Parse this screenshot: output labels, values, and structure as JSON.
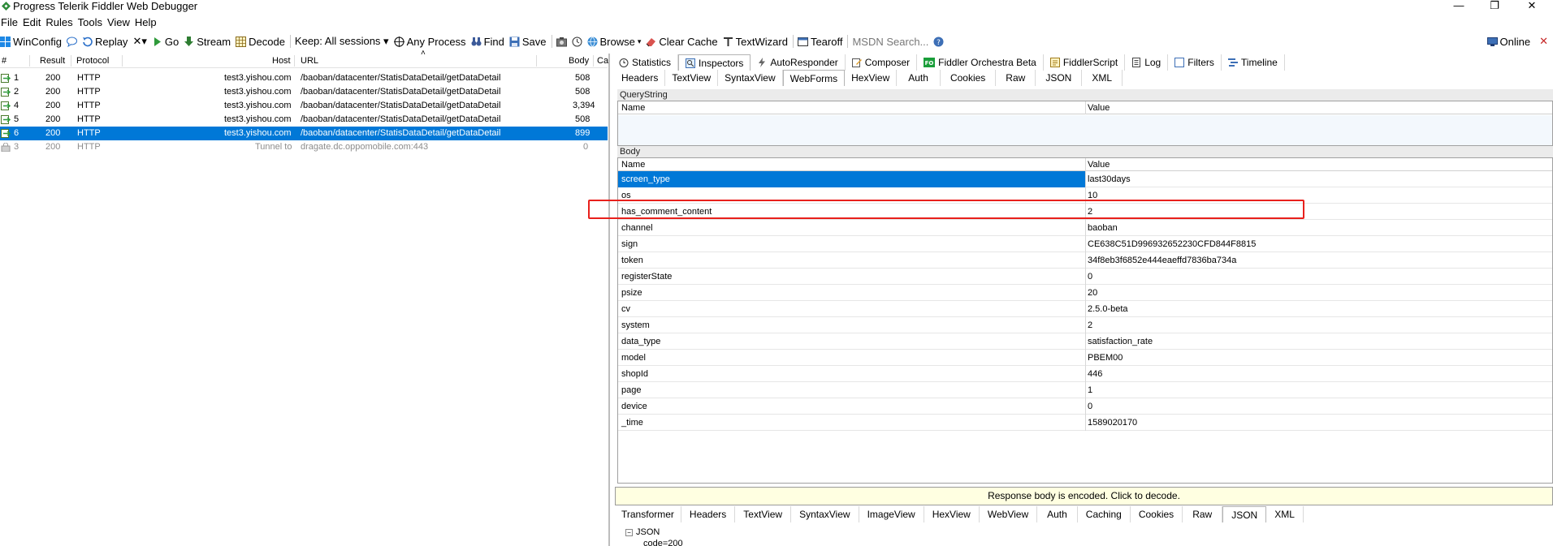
{
  "window": {
    "title": "Progress Telerik Fiddler Web Debugger",
    "minimize": "—",
    "restore": "❐",
    "close": "✕"
  },
  "menu": [
    "File",
    "Edit",
    "Rules",
    "Tools",
    "View",
    "Help"
  ],
  "toolbar": {
    "winconfig": "WinConfig",
    "replay": "Replay",
    "remove": "✕▾",
    "go": "Go",
    "stream": "Stream",
    "decode": "Decode",
    "keep": "Keep: All sessions ▾",
    "any_process": "Any Process",
    "find": "Find",
    "save": "Save",
    "browse": "Browse",
    "clear_cache": "Clear Cache",
    "textwizard": "TextWizard",
    "tearoff": "Tearoff",
    "msdn_search": "MSDN Search...",
    "online": "Online"
  },
  "sessions": {
    "columns": {
      "num": "#",
      "result": "Result",
      "protocol": "Protocol",
      "host": "Host",
      "url": "URL",
      "body": "Body",
      "caching": "Ca"
    },
    "rows": [
      {
        "num": "1",
        "result": "200",
        "protocol": "HTTP",
        "host": "test3.yishou.com",
        "url": "/baoban/datacenter/StatisDataDetail/getDataDetail",
        "body": "508"
      },
      {
        "num": "2",
        "result": "200",
        "protocol": "HTTP",
        "host": "test3.yishou.com",
        "url": "/baoban/datacenter/StatisDataDetail/getDataDetail",
        "body": "508"
      },
      {
        "num": "4",
        "result": "200",
        "protocol": "HTTP",
        "host": "test3.yishou.com",
        "url": "/baoban/datacenter/StatisDataDetail/getDataDetail",
        "body": "3,394"
      },
      {
        "num": "5",
        "result": "200",
        "protocol": "HTTP",
        "host": "test3.yishou.com",
        "url": "/baoban/datacenter/StatisDataDetail/getDataDetail",
        "body": "508"
      },
      {
        "num": "6",
        "result": "200",
        "protocol": "HTTP",
        "host": "test3.yishou.com",
        "url": "/baoban/datacenter/StatisDataDetail/getDataDetail",
        "body": "899"
      },
      {
        "num": "3",
        "result": "200",
        "protocol": "HTTP",
        "host": "Tunnel to",
        "url": "dragate.dc.oppomobile.com:443",
        "body": "0"
      }
    ]
  },
  "top_tabs": [
    "Statistics",
    "Inspectors",
    "AutoResponder",
    "Composer",
    "Fiddler Orchestra Beta",
    "FiddlerScript",
    "Log",
    "Filters",
    "Timeline"
  ],
  "request_tabs": [
    "Headers",
    "TextView",
    "SyntaxView",
    "WebForms",
    "HexView",
    "Auth",
    "Cookies",
    "Raw",
    "JSON",
    "XML"
  ],
  "querystring": {
    "caption": "QueryString",
    "col_name": "Name",
    "col_value": "Value"
  },
  "body": {
    "caption": "Body",
    "col_name": "Name",
    "col_value": "Value",
    "rows": [
      {
        "name": "screen_type",
        "value": "last30days"
      },
      {
        "name": "os",
        "value": "10"
      },
      {
        "name": "has_comment_content",
        "value": "2"
      },
      {
        "name": "channel",
        "value": "baoban"
      },
      {
        "name": "sign",
        "value": "CE638C51D996932652230CFD844F8815"
      },
      {
        "name": "token",
        "value": "34f8eb3f6852e444eaeffd7836ba734a"
      },
      {
        "name": "registerState",
        "value": "0"
      },
      {
        "name": "psize",
        "value": "20"
      },
      {
        "name": "cv",
        "value": "2.5.0-beta"
      },
      {
        "name": "system",
        "value": "2"
      },
      {
        "name": "data_type",
        "value": "satisfaction_rate"
      },
      {
        "name": "model",
        "value": "PBEM00"
      },
      {
        "name": "shopId",
        "value": "446"
      },
      {
        "name": "page",
        "value": "1"
      },
      {
        "name": "device",
        "value": "0"
      },
      {
        "name": "_time",
        "value": "1589020170"
      }
    ]
  },
  "response_notice": "Response body is encoded. Click to decode.",
  "response_tabs": [
    "Transformer",
    "Headers",
    "TextView",
    "SyntaxView",
    "ImageView",
    "HexView",
    "WebView",
    "Auth",
    "Caching",
    "Cookies",
    "Raw",
    "JSON",
    "XML"
  ],
  "json_tree": {
    "root": "JSON",
    "child": "code=200"
  },
  "colors": {
    "selection": "#0078d7",
    "highlight_box": "#e8201c",
    "notice_bg": "#ffffe1"
  }
}
